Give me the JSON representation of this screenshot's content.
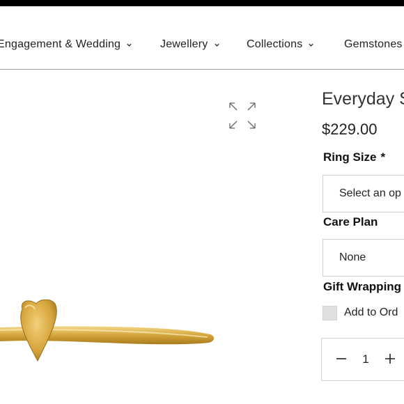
{
  "nav": {
    "items": [
      {
        "label": "Engagement & Wedding"
      },
      {
        "label": "Jewellery"
      },
      {
        "label": "Collections"
      },
      {
        "label": "Gemstones"
      }
    ]
  },
  "product": {
    "title": "Everyday S",
    "price": "$229.00"
  },
  "options": {
    "ring_size_label": "Ring Size",
    "required_mark": "*",
    "ring_size_value": "Select an op",
    "care_plan_label": "Care Plan",
    "care_plan_value": "None",
    "gift_wrapping_label": "Gift Wrapping",
    "gift_wrapping_checkbox_label": "Add to Ord",
    "gift_wrapping_checked": false
  },
  "quantity": {
    "value": "1"
  },
  "icons": {
    "chevron": "chevron-down-icon",
    "expand": "expand-icon",
    "minus": "minus-icon",
    "plus": "plus-icon"
  },
  "colors": {
    "gold": "#d4a53a",
    "topbar": "#000000",
    "border": "#cfcfcf"
  }
}
